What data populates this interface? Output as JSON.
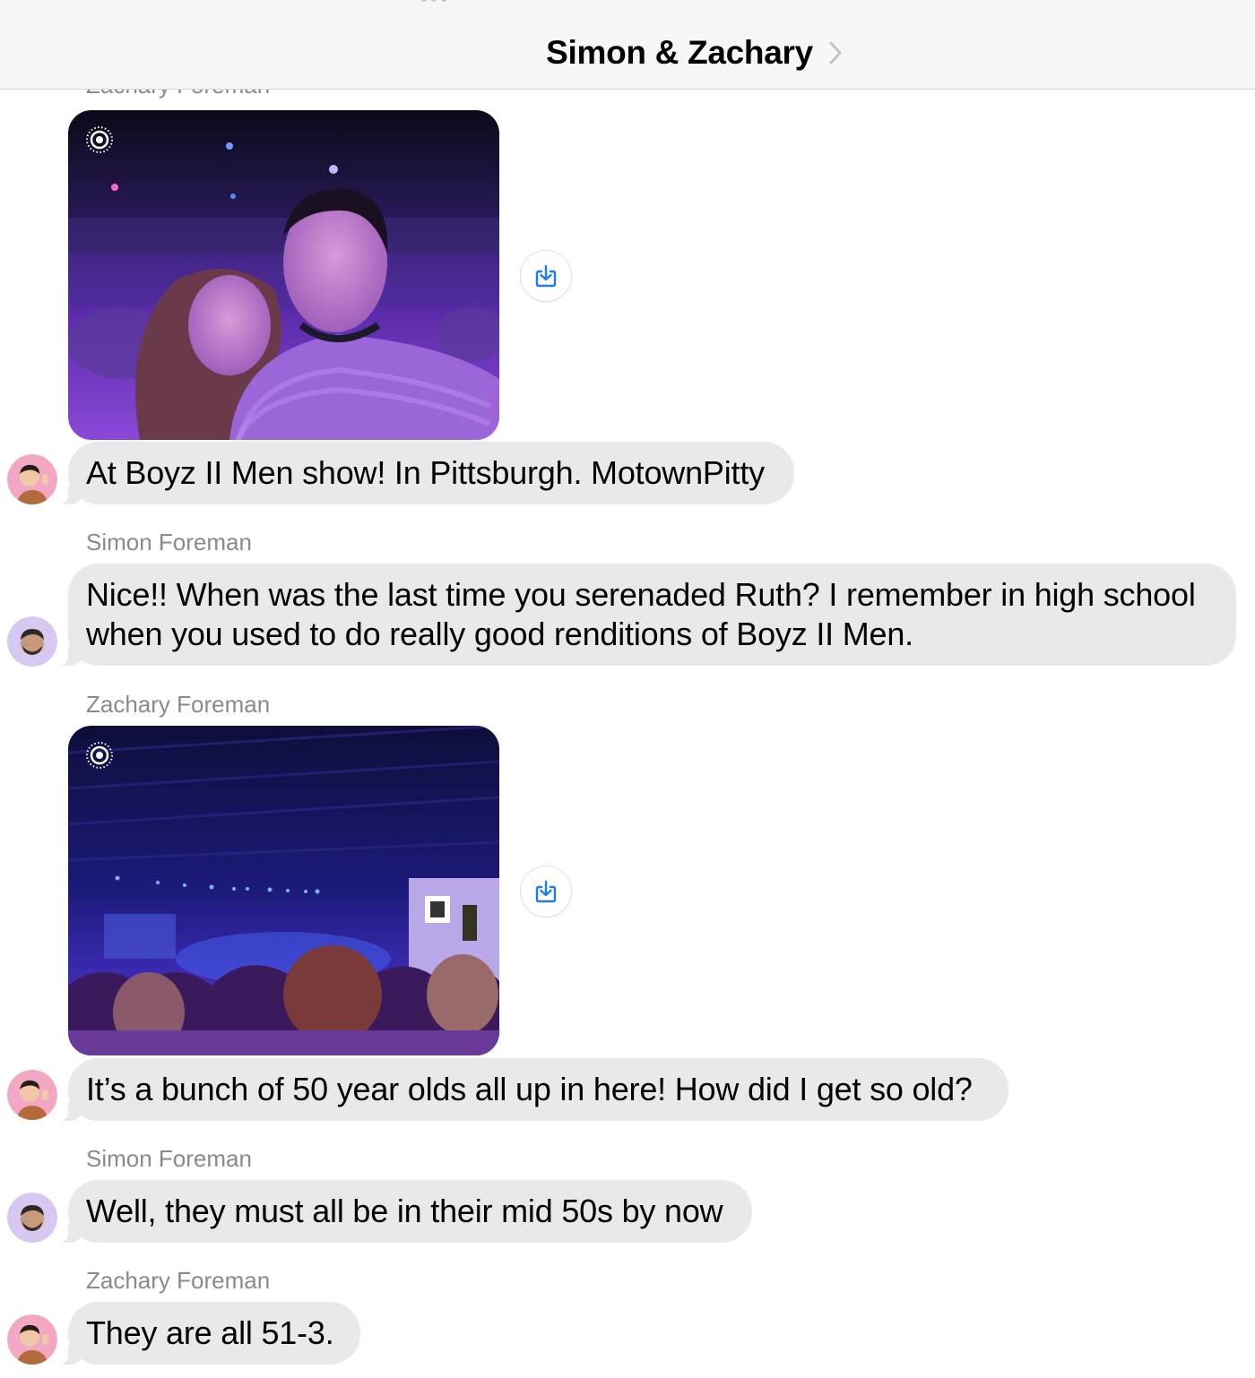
{
  "header": {
    "title": "Simon & Zachary"
  },
  "colors": {
    "bubble": "#e9e9eb",
    "accent": "#1b7cf5",
    "sender": "#8a8a8e"
  },
  "messages": [
    {
      "sender": "Zachary Foreman",
      "type": "photo",
      "alt": "Selfie of two people at a concert with purple lighting"
    },
    {
      "type": "text",
      "text": "At Boyz II Men show! In Pittsburgh. MotownPitty"
    },
    {
      "sender": "Simon Foreman",
      "type": "text",
      "text": "Nice!! When was the last time you serenaded Ruth? I remember in high school when you used to do really good renditions of Boyz II Men."
    },
    {
      "sender": "Zachary Foreman",
      "type": "photo",
      "alt": "Concert venue with stage, blue lights and crowd"
    },
    {
      "type": "text",
      "text": "It’s a bunch of 50 year olds all up in here! How did I get so old?"
    },
    {
      "sender": "Simon Foreman",
      "type": "text",
      "text": "Well, they must all be in their mid 50s by now"
    },
    {
      "sender": "Zachary Foreman",
      "type": "text",
      "text": "They are all 51-3."
    }
  ]
}
